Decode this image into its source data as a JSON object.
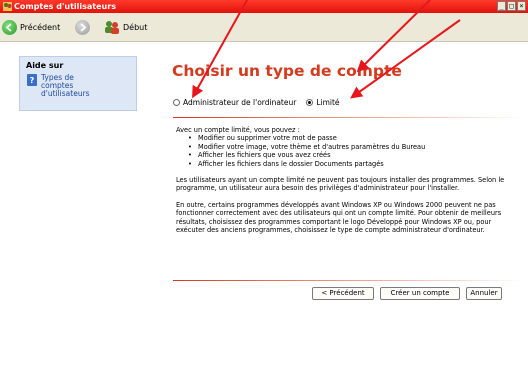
{
  "window": {
    "title": "Comptes d'utilisateurs",
    "controls": [
      "_",
      "□",
      "×"
    ]
  },
  "toolbar": {
    "back_label": "Précédent",
    "home_label": "Début"
  },
  "sidebar": {
    "help_title": "Aide sur",
    "help_link": "Types de comptes d'utilisateurs"
  },
  "main": {
    "heading": "Choisir un type de compte",
    "radios": [
      {
        "label": "Administrateur de l'ordinateur",
        "selected": false
      },
      {
        "label": "Limité",
        "selected": true
      }
    ],
    "intro": "Avec un compte limité, vous pouvez :",
    "bullets": [
      "Modifier ou supprimer votre mot de passe",
      "Modifier votre image, votre thème et d'autres paramètres du Bureau",
      "Afficher les fichiers que vous avez créés",
      "Afficher les fichiers dans le dossier Documents partagés"
    ],
    "para1": "Les utilisateurs ayant un compte limité ne peuvent pas toujours installer des programmes. Selon le programme, un utilisateur aura besoin des privilèges d'administrateur pour l'installer.",
    "para2": "En outre, certains programmes développés avant Windows XP ou Windows 2000 peuvent ne pas fonctionner correctement avec des utilisateurs qui ont un compte limité. Pour obtenir de meilleurs résultats, choisissez des programmes comportant le logo Développé pour Windows XP ou, pour exécuter des anciens programmes, choisissez le type de compte administrateur d'ordinateur.",
    "buttons": {
      "back": "< Précédent",
      "create": "Créer un compte",
      "cancel": "Annuler"
    }
  },
  "colors": {
    "title_bar": "#e1120a",
    "heading": "#d33a1e",
    "arrow": "#e8161c",
    "help_box": "#dde7f6"
  }
}
